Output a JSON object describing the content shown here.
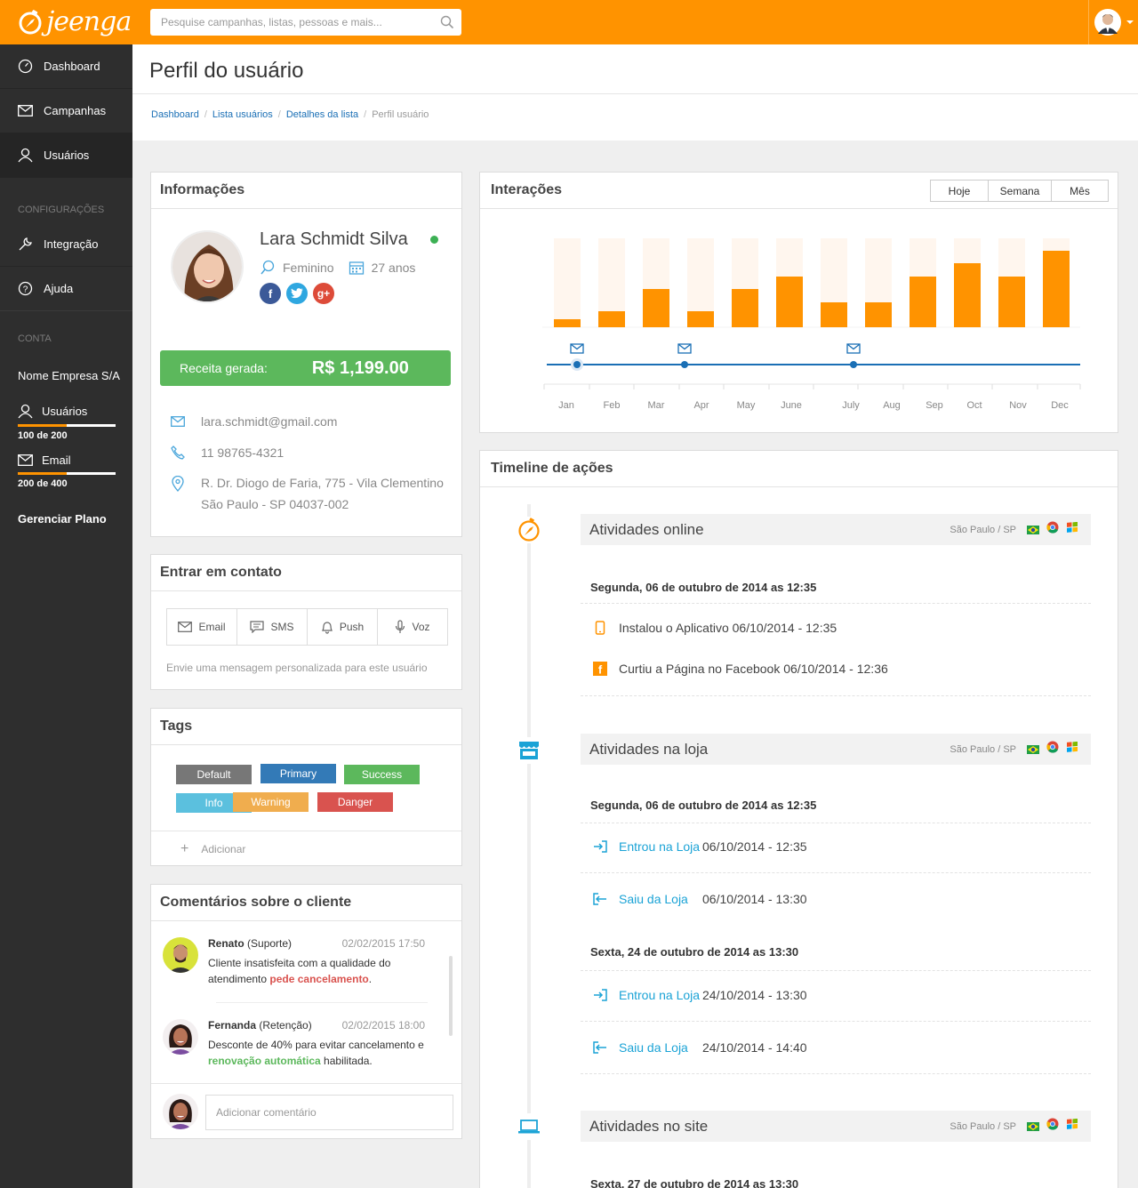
{
  "brand": {
    "logo_text": "jeenga"
  },
  "search": {
    "placeholder": "Pesquise campanhas, listas, pessoas e mais..."
  },
  "sidebar": {
    "items": [
      {
        "label": "Dashboard",
        "icon": "speedometer-icon"
      },
      {
        "label": "Campanhas",
        "icon": "envelope-icon"
      },
      {
        "label": "Usuários",
        "icon": "user-icon"
      }
    ],
    "config_header": "CONFIGURAÇÕES",
    "config_items": [
      {
        "label": "Integração",
        "icon": "wrench-icon"
      },
      {
        "label": "Ajuda",
        "icon": "help-icon"
      }
    ],
    "account_header": "CONTA",
    "company": "Nome Empresa S/A",
    "usage": [
      {
        "label": "Usuários",
        "count": "100 de 200",
        "fraction": 0.5
      },
      {
        "label": "Email",
        "count": "200 de 400",
        "fraction": 0.5
      }
    ],
    "manage_plan": "Gerenciar Plano"
  },
  "page": {
    "title": "Perfil do usuário",
    "breadcrumbs": [
      "Dashboard",
      "Lista usuários",
      "Detalhes da lista",
      "Perfil usuário"
    ]
  },
  "info": {
    "title": "Informações",
    "name": "Lara Schmidt Silva",
    "gender": "Feminino",
    "age": "27 anos",
    "revenue_label": "Receita gerada:",
    "revenue_value": "R$ 1,199.00",
    "email": "lara.schmidt@gmail.com",
    "phone": "11 98765-4321",
    "address_line1": "R. Dr. Diogo de Faria, 775 - Vila Clementino",
    "address_line2": "São Paulo - SP 04037-002",
    "colors": {
      "online": "#3cb054",
      "revenue_bg": "#5cb85c"
    }
  },
  "contact": {
    "title": "Entrar em contato",
    "buttons": [
      "Email",
      "SMS",
      "Push",
      "Voz"
    ],
    "note": "Envie uma mensagem personalizada para este usuário"
  },
  "tags": {
    "title": "Tags",
    "items": [
      {
        "label": "Default",
        "color": "#777777"
      },
      {
        "label": "Primary",
        "color": "#337ab7"
      },
      {
        "label": "Success",
        "color": "#5cb85c"
      },
      {
        "label": "Info",
        "color": "#5bc0de"
      },
      {
        "label": "Warning",
        "color": "#f0ad4e"
      },
      {
        "label": "Danger",
        "color": "#d9534f"
      }
    ],
    "add_label": "Adicionar"
  },
  "comments": {
    "title": "Comentários sobre o cliente",
    "items": [
      {
        "name": "Renato",
        "role": "(Suporte)",
        "date": "02/02/2015 17:50",
        "text_pre": "Cliente insatisfeita com a qualidade do atendimento ",
        "text_hl": "pede cancelamento",
        "text_post": "."
      },
      {
        "name": "Fernanda",
        "role": "(Retenção)",
        "date": "02/02/2015 18:00",
        "text_pre": "Desconte de 40% para evitar cancelamento e ",
        "text_hl": "renovação automática",
        "text_post": " habilitada."
      }
    ],
    "input_placeholder": "Adicionar comentário"
  },
  "interactions": {
    "title": "Interações",
    "periods": [
      "Hoje",
      "Semana",
      "Mês"
    ]
  },
  "chart_data": {
    "type": "bar",
    "categories": [
      "Jan",
      "Feb",
      "Mar",
      "Apr",
      "May",
      "June",
      "July",
      "Aug",
      "Sep",
      "Oct",
      "Nov",
      "Dec"
    ],
    "values": [
      9,
      18,
      43,
      18,
      43,
      57,
      28,
      28,
      57,
      72,
      57,
      86
    ],
    "ylim": [
      0,
      100
    ],
    "email_markers": [
      "Jan",
      "Apr",
      "July"
    ],
    "colors": {
      "bar": "#ff9300",
      "bar_bg": "#fff6ee",
      "timeline": "#1a6fb5"
    }
  },
  "timeline": {
    "title": "Timeline de ações",
    "sections": [
      {
        "title": "Atividades online",
        "location": "São Paulo / SP",
        "icon": "compass-icon",
        "groups": [
          {
            "date": "Segunda, 06 de outubro de 2014 as 12:35",
            "actions": [
              {
                "icon": "mobile-icon",
                "text": "Instalou o Aplicativo  06/10/2014 - 12:35"
              },
              {
                "icon": "facebook-icon",
                "text": "Curtiu a Página no Facebook 06/10/2014 - 12:36"
              }
            ]
          }
        ]
      },
      {
        "title": "Atividades na loja",
        "location": "São Paulo / SP",
        "icon": "store-icon",
        "groups": [
          {
            "date": "Segunda, 06 de outubro de 2014 as 12:35",
            "actions": [
              {
                "icon": "enter-icon",
                "link": "Entrou na Loja",
                "time": "06/10/2014 - 12:35"
              },
              {
                "icon": "exit-icon",
                "link": "Saiu da Loja",
                "time": "06/10/2014 - 13:30"
              }
            ]
          },
          {
            "date": "Sexta, 24 de outubro de 2014 as 13:30",
            "actions": [
              {
                "icon": "enter-icon",
                "link": "Entrou na Loja",
                "time": "24/10/2014 - 13:30"
              },
              {
                "icon": "exit-icon",
                "link": "Saiu da Loja",
                "time": "24/10/2014 - 14:40"
              }
            ]
          }
        ]
      },
      {
        "title": "Atividades no site",
        "location": "São Paulo / SP",
        "icon": "laptop-icon",
        "groups": [
          {
            "date": "Sexta, 27 de outubro de 2014 as 13:30",
            "actions": []
          }
        ]
      }
    ]
  }
}
